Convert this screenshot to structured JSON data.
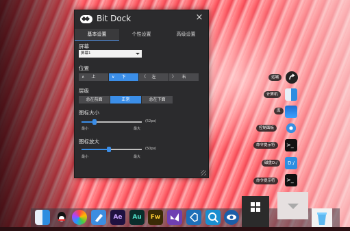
{
  "window": {
    "title": "Bit Dock",
    "close_icon": "×",
    "tabs": [
      {
        "label": "基本设置"
      },
      {
        "label": "个性设置"
      },
      {
        "label": "高级设置"
      }
    ],
    "screen": {
      "label": "屏幕",
      "selected": "屏幕1"
    },
    "position": {
      "label": "位置",
      "options": [
        "上",
        "下",
        "左",
        "右"
      ],
      "chevrons": [
        "∧",
        "∨",
        "〈",
        "〉"
      ],
      "selected": "下"
    },
    "layer": {
      "label": "层级",
      "options": [
        "总在前面",
        "正常",
        "总在下面"
      ],
      "selected": "正常"
    },
    "icon_size": {
      "label": "图标大小",
      "value_text": "(52px)",
      "min": "最小",
      "max": "最大",
      "level": 0.22
    },
    "icon_zoom": {
      "label": "图标放大",
      "value_text": "(50px)",
      "min": "最小",
      "max": "最大",
      "level": 0.45
    }
  },
  "right_dock": {
    "items": [
      {
        "label": "远端",
        "icon": "arrow-icon"
      },
      {
        "label": "计算机",
        "icon": "finder-icon"
      },
      {
        "label": "库",
        "icon": "library-icon"
      },
      {
        "label": "控制面板",
        "icon": "settings-gear-icon"
      },
      {
        "label": "命令提示符",
        "icon": "terminal-icon"
      },
      {
        "label": "磁盘D:/",
        "icon": "disk-icon",
        "icon_text": "D:/"
      },
      {
        "label": "命令提示符",
        "icon": "terminal-icon"
      }
    ]
  },
  "taskbar": {
    "apps": [
      {
        "name": "finder-icon",
        "text": "",
        "color": "#e6eef6"
      },
      {
        "name": "qq-icon",
        "text": "",
        "color": "#1a1a1a"
      },
      {
        "name": "photos-icon",
        "text": "",
        "color": "#ffffff"
      },
      {
        "name": "pencil-icon",
        "text": "",
        "color": "#3d8de0"
      },
      {
        "name": "after-effects-icon",
        "text": "Ae",
        "color": "#1f1140"
      },
      {
        "name": "audition-icon",
        "text": "Au",
        "color": "#0b2d2b"
      },
      {
        "name": "fireworks-icon",
        "text": "Fw",
        "color": "#3b2a06"
      },
      {
        "name": "visual-studio-icon",
        "text": "",
        "color": "#6f3fb2"
      },
      {
        "name": "vscode-icon",
        "text": "",
        "color": "#1e6fb8"
      },
      {
        "name": "search-icon",
        "text": "",
        "color": "#1a8fd0"
      },
      {
        "name": "eye-icon",
        "text": "",
        "color": "#1b5ea8"
      }
    ],
    "start_icon": "windows-icon",
    "collapse_icon": "triangle-down-icon",
    "recycle_icon": "recycle-bin-icon",
    "colors": {
      "accent": "#3b8ee8",
      "window_bg": "#2b2b2d"
    }
  }
}
